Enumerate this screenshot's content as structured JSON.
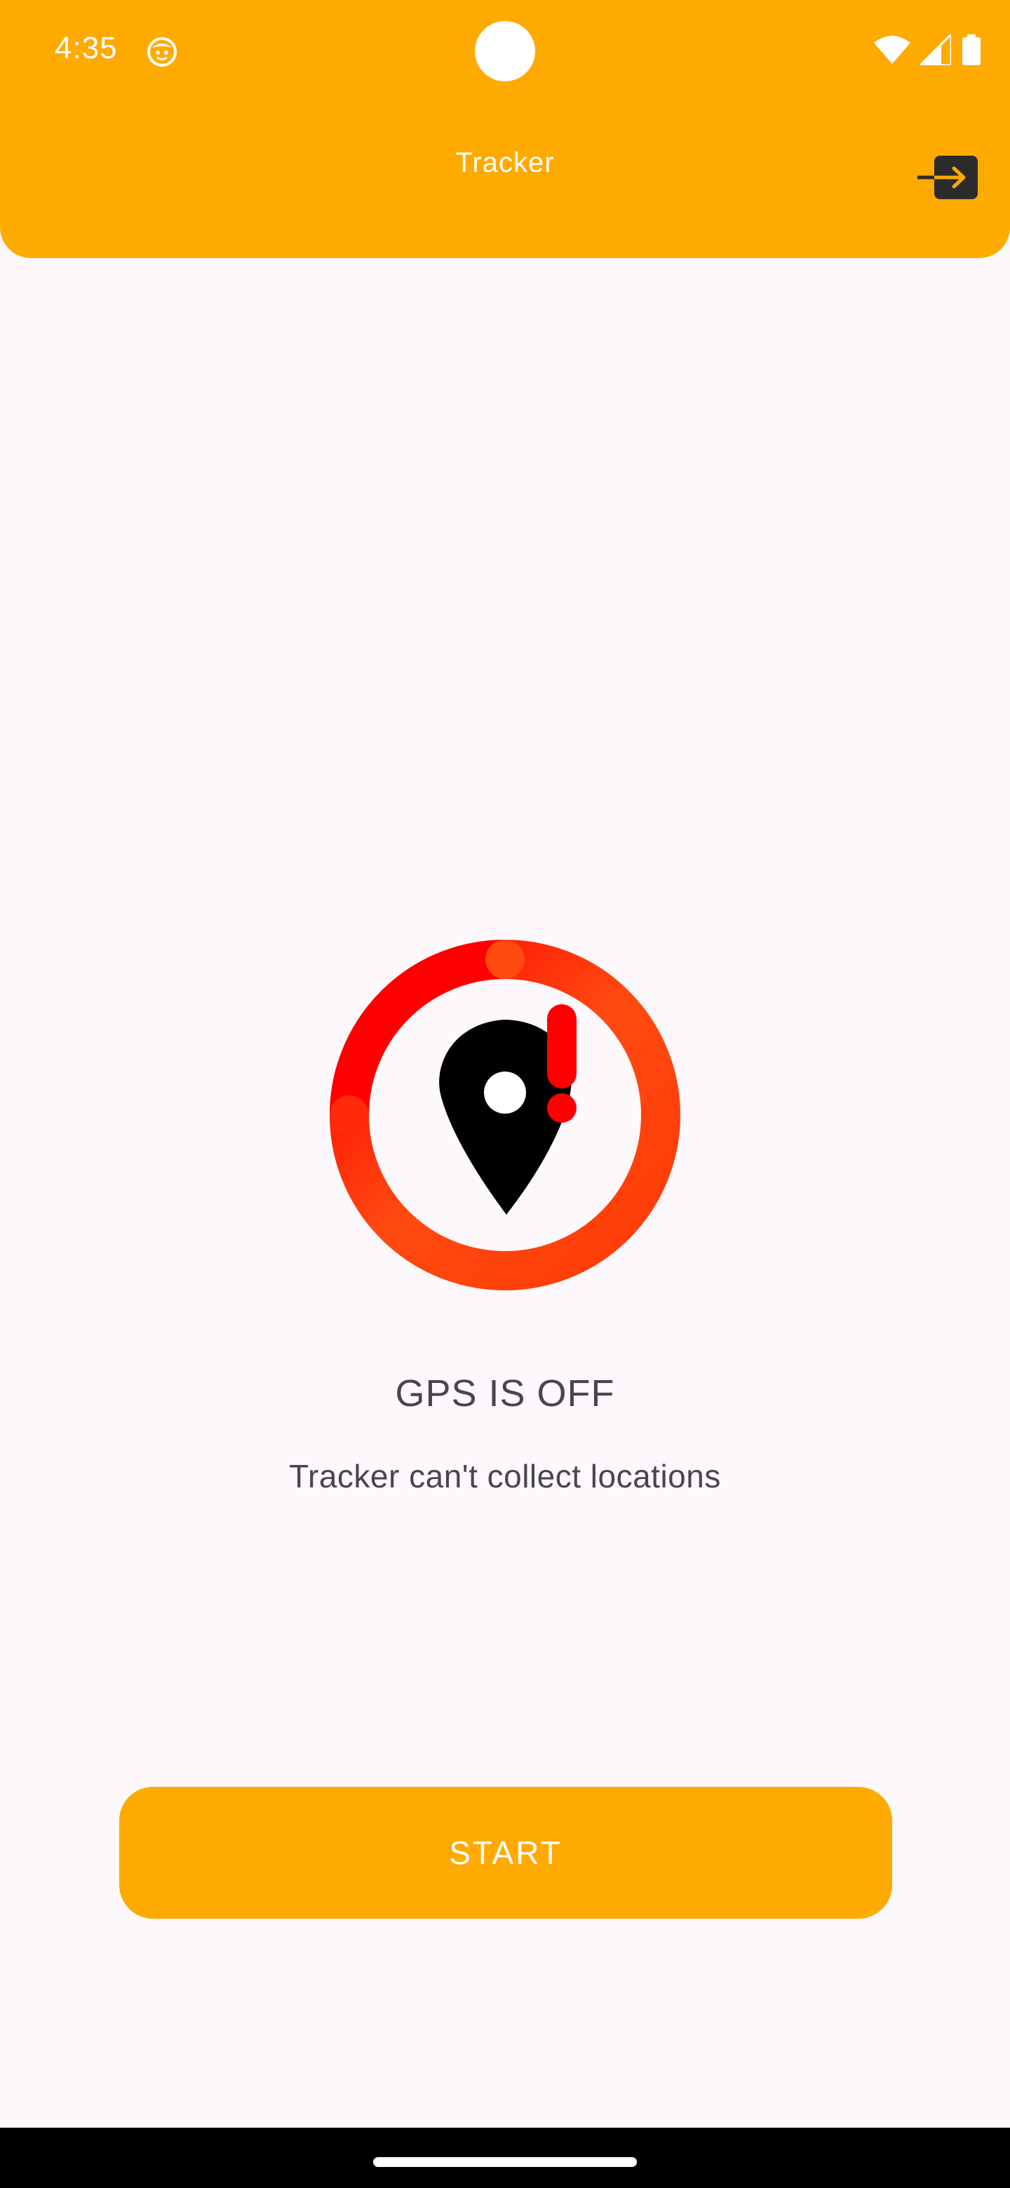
{
  "status_bar": {
    "time": "4:35",
    "app_icon": "notification-app-icon",
    "icons": [
      "wifi-icon",
      "cellular-signal-icon",
      "battery-icon"
    ]
  },
  "app_bar": {
    "title": "Tracker",
    "action_icon": "logout-icon"
  },
  "status_panel": {
    "icon": "location-pin-alert-icon",
    "title": "GPS IS OFF",
    "subtitle": "Tracker can't collect locations"
  },
  "start_button": {
    "label": "START"
  },
  "colors": {
    "accent": "#FFAA00",
    "background": "#FDF8FC",
    "ring_start": "#FF0000",
    "ring_end": "#FF4A10",
    "alert": "#FF0000",
    "text": "#49454F"
  }
}
